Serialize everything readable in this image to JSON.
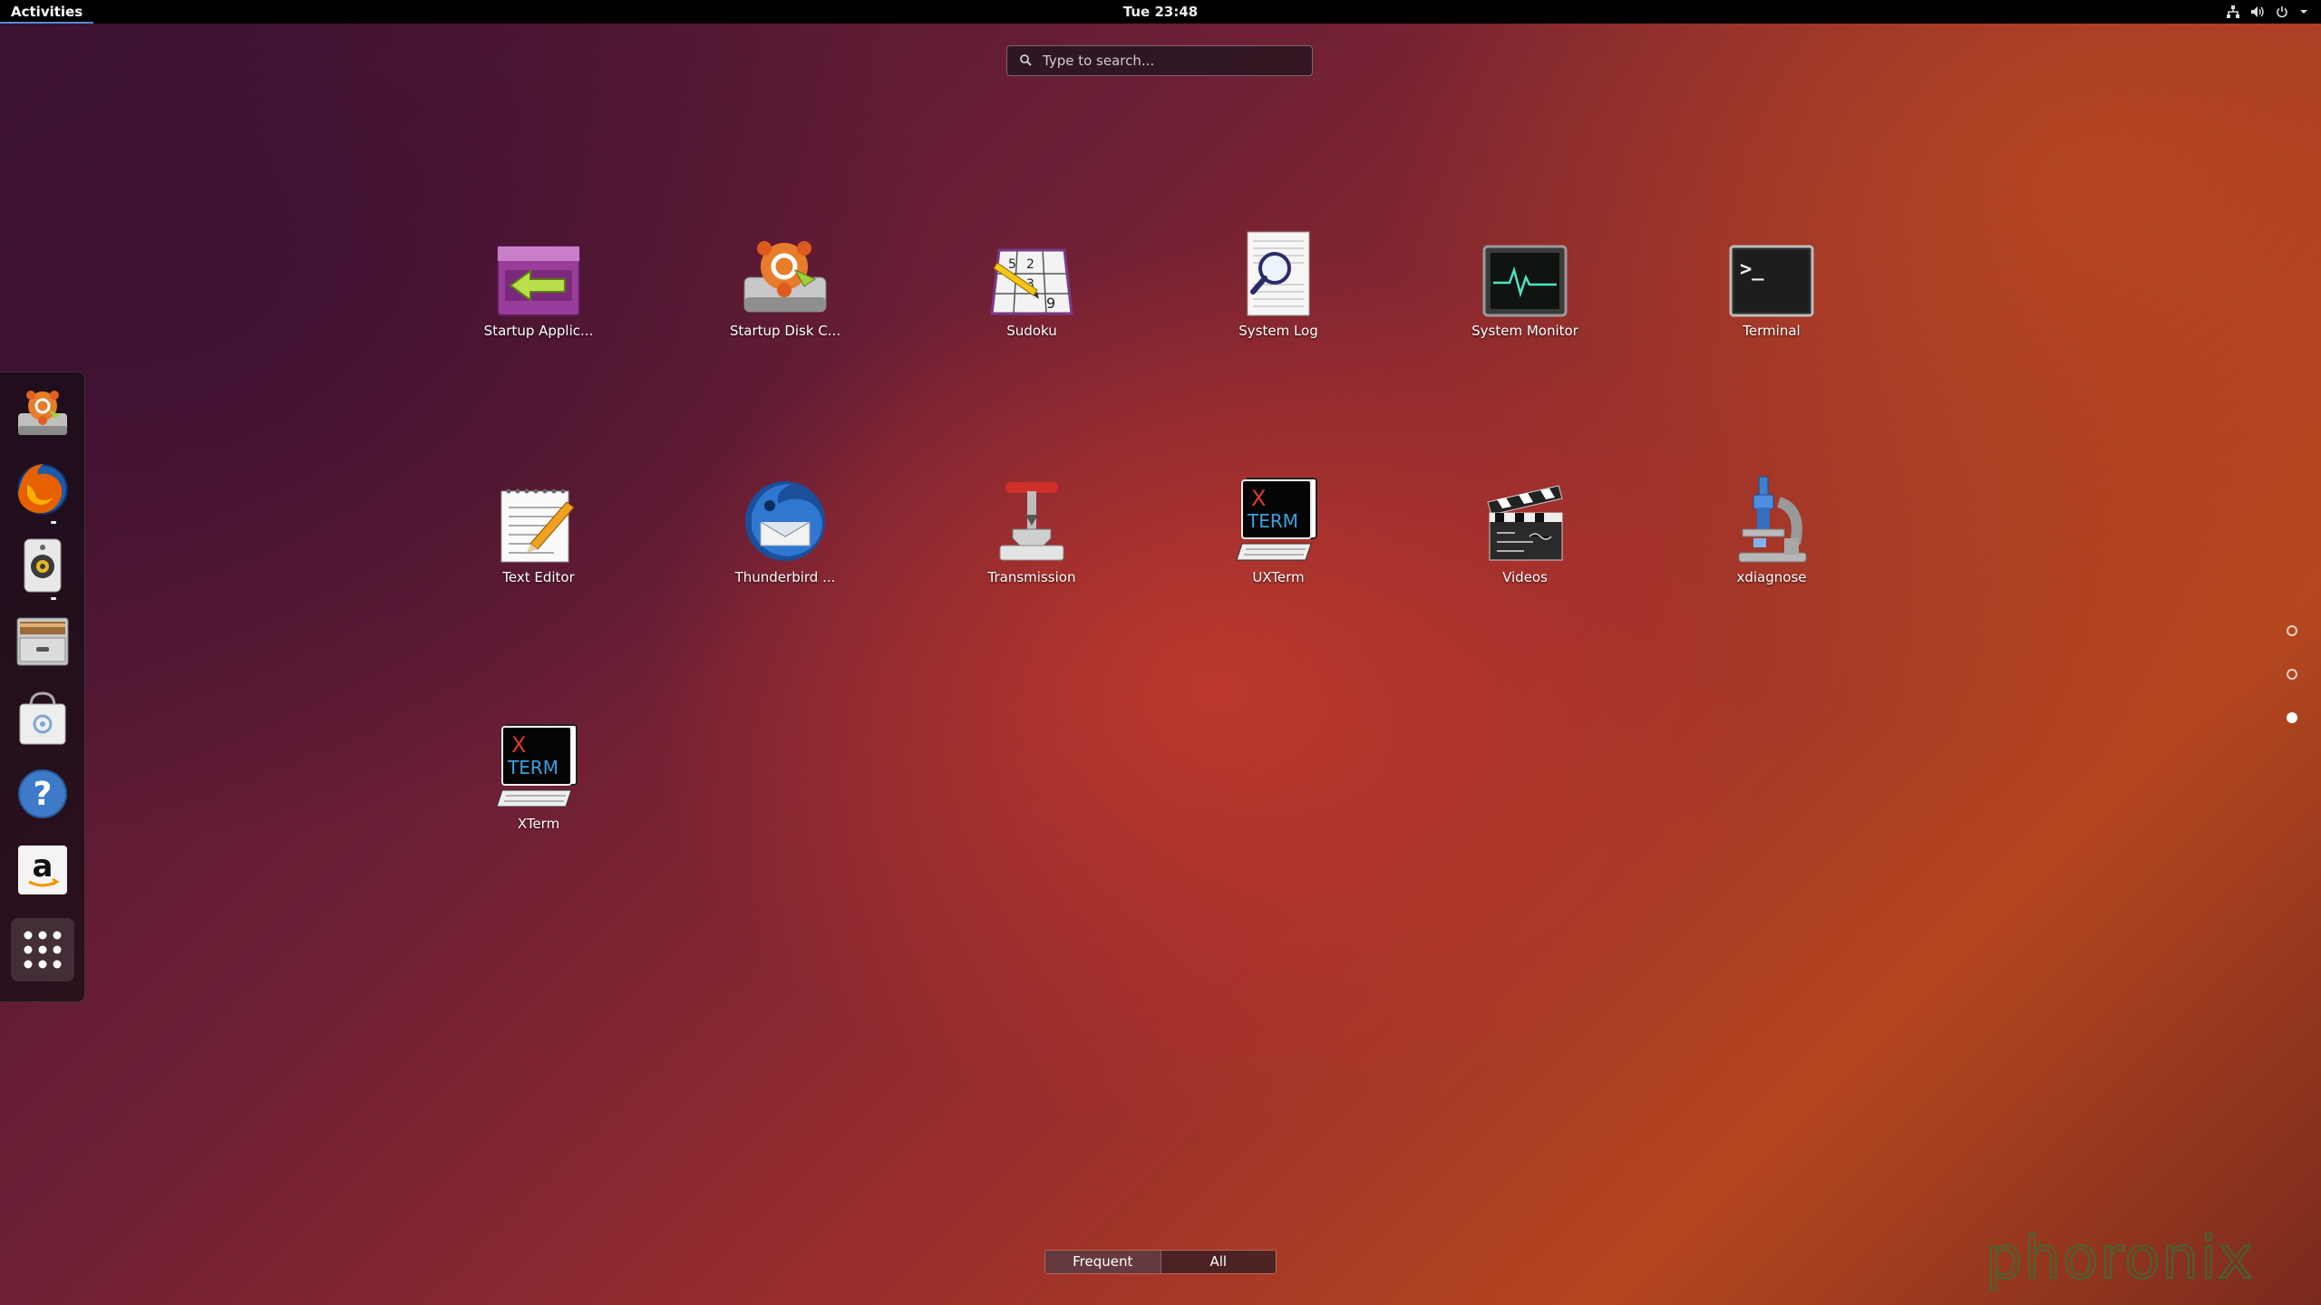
{
  "topbar": {
    "activities_label": "Activities",
    "clock": "Tue 23:48",
    "tray_icons": [
      "network-icon",
      "volume-icon",
      "power-icon",
      "chevron-down-icon"
    ]
  },
  "search": {
    "placeholder": "Type to search..."
  },
  "dock": {
    "items": [
      {
        "name": "startup-disk-creator",
        "icon": "startup-disk-icon"
      },
      {
        "name": "firefox",
        "icon": "firefox-icon"
      },
      {
        "name": "rhythmbox",
        "icon": "speaker-icon"
      },
      {
        "name": "files",
        "icon": "file-cabinet-icon"
      },
      {
        "name": "software-center",
        "icon": "shopping-bag-icon"
      },
      {
        "name": "help",
        "icon": "help-icon"
      },
      {
        "name": "amazon",
        "icon": "amazon-icon"
      },
      {
        "name": "show-applications",
        "icon": "grid-icon"
      }
    ]
  },
  "apps": [
    {
      "label": "Startup Applic...",
      "icon": "startup-applications-icon"
    },
    {
      "label": "Startup Disk C...",
      "icon": "startup-disk-icon"
    },
    {
      "label": "Sudoku",
      "icon": "sudoku-icon",
      "digits": [
        "5",
        "2",
        "3",
        "9"
      ]
    },
    {
      "label": "System Log",
      "icon": "system-log-icon"
    },
    {
      "label": "System Monitor",
      "icon": "system-monitor-icon"
    },
    {
      "label": "Terminal",
      "icon": "terminal-icon",
      "prompt": ">_"
    },
    {
      "label": "Text Editor",
      "icon": "text-editor-icon"
    },
    {
      "label": "Thunderbird ...",
      "icon": "thunderbird-icon"
    },
    {
      "label": "Transmission",
      "icon": "transmission-icon"
    },
    {
      "label": "UXTerm",
      "icon": "uxterm-icon",
      "glyph_x": "X",
      "glyph_term": "TERM"
    },
    {
      "label": "Videos",
      "icon": "clapperboard-icon"
    },
    {
      "label": "xdiagnose",
      "icon": "microscope-icon"
    },
    {
      "label": "XTerm",
      "icon": "xterm-icon",
      "glyph_x": "X",
      "glyph_term": "TERM"
    }
  ],
  "pages": {
    "total": 3,
    "current": 3
  },
  "view_switch": {
    "frequent_label": "Frequent",
    "all_label": "All",
    "selected": "All"
  },
  "watermark": "phoronix"
}
